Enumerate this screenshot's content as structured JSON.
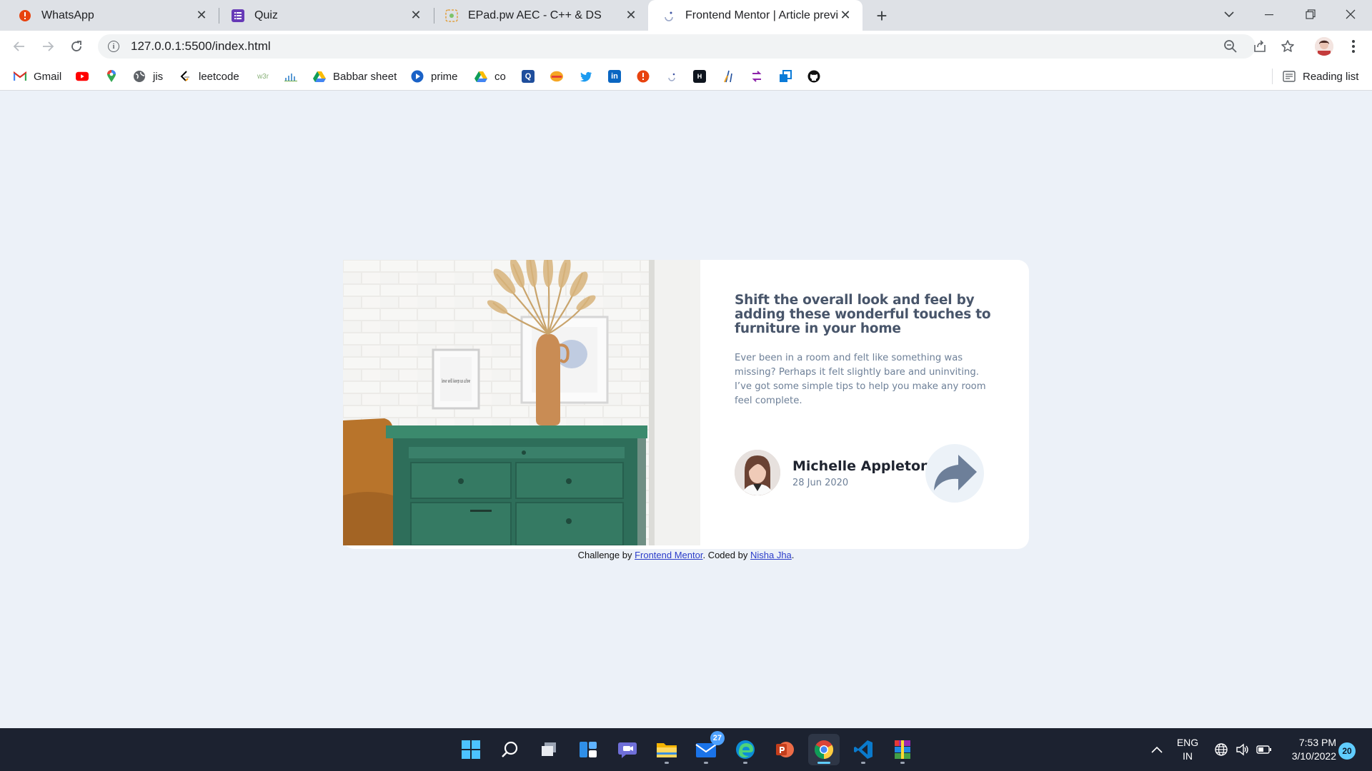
{
  "browser": {
    "tabs": [
      {
        "title": "WhatsApp",
        "icon": "whatsapp-icon",
        "active": false
      },
      {
        "title": "Quiz",
        "icon": "forms-icon",
        "active": false
      },
      {
        "title": "EPad.pw AEC - C++ & DS",
        "icon": "epad-icon",
        "active": false
      },
      {
        "title": "Frontend Mentor | Article previe",
        "icon": "frontend-mentor-icon",
        "active": true
      }
    ],
    "new_tab_label": "+",
    "address": "127.0.0.1:5500/index.html",
    "bookmarks": [
      {
        "label": "Gmail",
        "icon": "gmail-icon"
      },
      {
        "label": "",
        "icon": "youtube-icon"
      },
      {
        "label": "",
        "icon": "maps-icon"
      },
      {
        "label": "jis",
        "icon": "globe-icon"
      },
      {
        "label": "leetcode",
        "icon": "leetcode-icon"
      },
      {
        "label": "",
        "icon": "w3schools-icon"
      },
      {
        "label": "",
        "icon": "chart-bars-icon"
      },
      {
        "label": "Babbar sheet",
        "icon": "drive-icon"
      },
      {
        "label": "prime",
        "icon": "play-icon"
      },
      {
        "label": "co",
        "icon": "drive-icon"
      },
      {
        "label": "",
        "icon": "q-icon"
      },
      {
        "label": "",
        "icon": "burger-icon"
      },
      {
        "label": "",
        "icon": "twitter-icon"
      },
      {
        "label": "",
        "icon": "linkedin-icon"
      },
      {
        "label": "",
        "icon": "alert-icon"
      },
      {
        "label": "",
        "icon": "loader-icon"
      },
      {
        "label": "",
        "icon": "hackerrank-icon"
      },
      {
        "label": "",
        "icon": "ladder-icon"
      },
      {
        "label": "",
        "icon": "sync-icon"
      },
      {
        "label": "",
        "icon": "windows-app-icon"
      },
      {
        "label": "",
        "icon": "github-icon"
      }
    ],
    "reading_list_label": "Reading list"
  },
  "card": {
    "headline": "Shift the overall look and feel by adding these wonderful touches to furniture in your home",
    "excerpt": "Ever been in a room and felt like something was missing? Perhaps it felt slightly bare and uninviting. I’ve got some simple tips to help you make any room feel complete.",
    "author": {
      "name": "Michelle Appleton",
      "date": "28 Jun 2020"
    },
    "frame_text": "love will keep us alive"
  },
  "attribution": {
    "prefix": "Challenge by ",
    "link1": "Frontend Mentor",
    "middle": ". Coded by ",
    "link2": "Nisha Jha",
    "suffix": "."
  },
  "taskbar": {
    "apps": [
      "windows-start-icon",
      "search-icon",
      "task-view-icon",
      "widgets-icon",
      "teams-chat-icon",
      "file-explorer-icon",
      "mail-icon",
      "edge-icon",
      "powerpoint-icon",
      "chrome-icon",
      "vscode-icon",
      "winrar-icon"
    ],
    "mail_badge": "27",
    "lang_top": "ENG",
    "lang_bottom": "IN",
    "time": "7:53 PM",
    "date": "3/10/2022",
    "notifications": "20"
  },
  "colors": {
    "page_bg": "#ecf1f8",
    "headline": "#48556a",
    "muted": "#6e8098",
    "dresser": "#2e6e5a"
  }
}
